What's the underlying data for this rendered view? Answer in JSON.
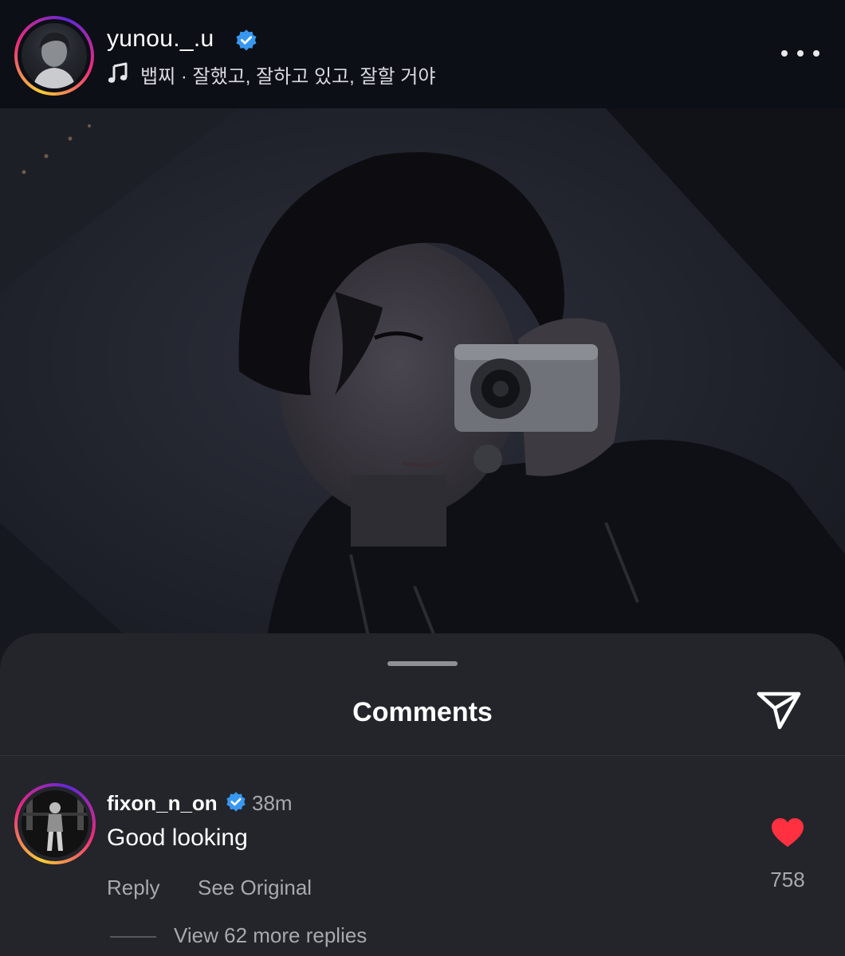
{
  "post": {
    "username": "yunou._.u",
    "verified": true,
    "music": "뱁찌 · 잘했고, 잘하고 있고, 잘할 거야",
    "more_icon": "more-horizontal-icon"
  },
  "comments_sheet": {
    "title": "Comments",
    "share_icon": "paper-plane-icon"
  },
  "comments": [
    {
      "username": "fixon_n_on",
      "verified": true,
      "time": "38m",
      "text": "Good looking",
      "reply_label": "Reply",
      "see_original_label": "See Original",
      "likes": "758",
      "liked": true,
      "view_replies_label": "View 62 more replies"
    }
  ],
  "colors": {
    "background": "#0b0d12",
    "sheet": "#23252b",
    "verified_badge": "#3897f0",
    "like_heart": "#ff3040",
    "secondary_text": "#a7a9ae"
  }
}
